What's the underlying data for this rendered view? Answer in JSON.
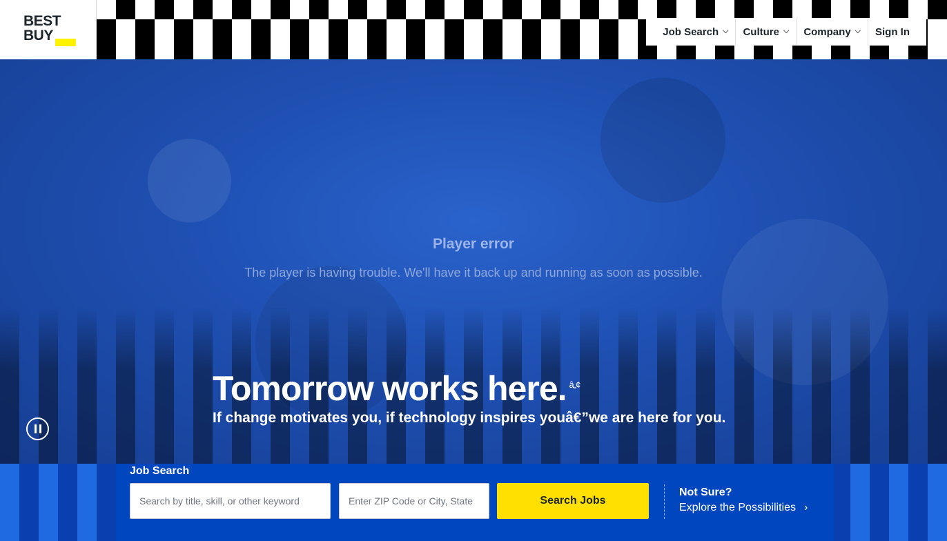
{
  "brand": {
    "logo_line1": "BEST",
    "logo_line2": "BUY",
    "colors": {
      "blue": "#0046be",
      "yellow": "#ffe000",
      "dark": "#1d252c"
    }
  },
  "nav": {
    "items": [
      {
        "label": "Job Search",
        "has_dropdown": true
      },
      {
        "label": "Culture",
        "has_dropdown": true
      },
      {
        "label": "Company",
        "has_dropdown": true
      },
      {
        "label": "Sign In",
        "has_dropdown": false
      }
    ]
  },
  "hero": {
    "player_error_title": "Player error",
    "player_error_message": "The player is having trouble. We'll have it back up and running as soon as possible.",
    "headline": "Tomorrow works here.",
    "headline_mark": "â„¢",
    "subhead": "If change motivates you, if technology inspires youâ€”we are here for you.",
    "pause_icon": "pause-icon"
  },
  "search": {
    "label": "Job Search",
    "keyword_placeholder": "Search by title, skill, or other keyword",
    "location_placeholder": "Enter ZIP Code or City, State",
    "button_label": "Search Jobs",
    "not_sure_title": "Not Sure?",
    "explore_label": "Explore the Possibilities",
    "explore_icon": "chevron-right-icon"
  }
}
